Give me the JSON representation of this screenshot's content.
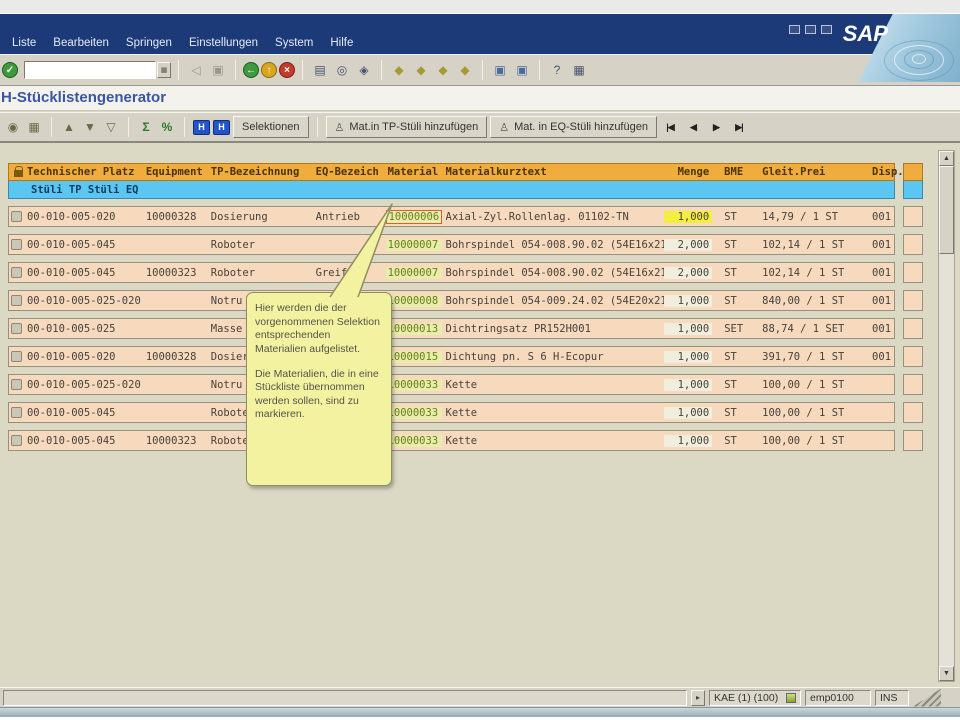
{
  "window": {
    "logo_text": "SAP"
  },
  "menubar": {
    "items": [
      "Liste",
      "Bearbeiten",
      "Springen",
      "Einstellungen",
      "System",
      "Hilfe"
    ]
  },
  "toolbar": {
    "command_value": "",
    "enter_glyph": "✓",
    "pre_icons": [
      {
        "name": "continue-icon",
        "glyph": "◁"
      },
      {
        "name": "save-icon",
        "glyph": "▣"
      }
    ],
    "group_nav": [
      {
        "name": "back-icon",
        "glyph": "←",
        "style": "circ green"
      },
      {
        "name": "exit-icon",
        "glyph": "↑",
        "style": "circ yellow"
      },
      {
        "name": "cancel-icon",
        "glyph": "×",
        "style": "circ red"
      }
    ],
    "group_print": [
      {
        "name": "print-icon",
        "glyph": "▤"
      },
      {
        "name": "find-icon",
        "glyph": "◎"
      },
      {
        "name": "find-next-icon",
        "glyph": "◈"
      }
    ],
    "group_page": [
      {
        "name": "first-page-icon",
        "glyph": "◆"
      },
      {
        "name": "prev-page-icon",
        "glyph": "◆"
      },
      {
        "name": "next-page-icon",
        "glyph": "◆"
      },
      {
        "name": "last-page-icon",
        "glyph": "◆"
      }
    ],
    "group_win": [
      {
        "name": "new-session-icon",
        "glyph": "▣"
      },
      {
        "name": "create-shortcut-icon",
        "glyph": "▣"
      }
    ],
    "group_help": [
      {
        "name": "help-icon",
        "glyph": "?"
      },
      {
        "name": "customize-icon",
        "glyph": "▦"
      }
    ]
  },
  "title": "H-Stücklistengenerator",
  "apptoolbar": {
    "icons_left": [
      {
        "name": "choose-detail-icon",
        "glyph": "◉"
      },
      {
        "name": "grid-view-icon",
        "glyph": "▦"
      }
    ],
    "icons_sort": [
      {
        "name": "sort-ascending-icon",
        "glyph": "▲"
      },
      {
        "name": "sort-descending-icon",
        "glyph": "▼"
      },
      {
        "name": "filter-icon",
        "glyph": "▽"
      }
    ],
    "icons_calc": [
      {
        "name": "sum-icon",
        "glyph": "Σ"
      },
      {
        "name": "subtotal-icon",
        "glyph": "%"
      }
    ],
    "icons_info": [
      {
        "name": "stueli-tp-icon",
        "glyph": "H"
      },
      {
        "name": "stueli-eq-icon",
        "glyph": "H"
      }
    ],
    "selections_label": "Selektionen",
    "add_tp_label": "Mat.in TP-Stüli hinzufügen",
    "add_eq_label": "Mat. in EQ-Stüli hinzufügen",
    "nav": [
      {
        "name": "first-record-icon",
        "glyph": "|◀"
      },
      {
        "name": "prev-record-icon",
        "glyph": "◀"
      },
      {
        "name": "next-record-icon",
        "glyph": "▶"
      },
      {
        "name": "last-record-icon",
        "glyph": "▶|"
      }
    ]
  },
  "table": {
    "columns": [
      "Technischer Platz",
      "Equipment",
      "TP-Bezeichnung",
      "EQ-Bezeich",
      "Material",
      "Materialkurztext",
      "Menge",
      "BME",
      "Gleit.Prei",
      "Disp."
    ],
    "subheader": "Stüli TP Stüli EQ",
    "rows": [
      {
        "tp": "00-010-005-020",
        "equipment": "10000328",
        "tp_bez": "Dosierung",
        "eq_bez": "Antrieb",
        "material": "10000006",
        "text": "Axial-Zyl.Rollenlag. 01102-TN",
        "menge": "1,000",
        "bme": "ST",
        "preis": "14,79 / 1 ST",
        "disp": "001",
        "material_focused": true,
        "menge_focused": true
      },
      {
        "tp": "00-010-005-045",
        "equipment": "",
        "tp_bez": "Roboter",
        "eq_bez": "",
        "material": "10000007",
        "text": "Bohrspindel 054-008.90.02 (54E16x212)",
        "menge": "2,000",
        "bme": "ST",
        "preis": "102,14 / 1 ST",
        "disp": "001"
      },
      {
        "tp": "00-010-005-045",
        "equipment": "10000323",
        "tp_bez": "Roboter",
        "eq_bez": "Greifer",
        "material": "10000007",
        "text": "Bohrspindel 054-008.90.02 (54E16x212)",
        "menge": "2,000",
        "bme": "ST",
        "preis": "102,14 / 1 ST",
        "disp": "001"
      },
      {
        "tp": "00-010-005-025-020",
        "equipment": "",
        "tp_bez": "Notru",
        "eq_bez": "",
        "material": "10000008",
        "text": "Bohrspindel 054-009.24.02 (54E20x210)",
        "menge": "1,000",
        "bme": "ST",
        "preis": "840,00 / 1 ST",
        "disp": "001"
      },
      {
        "tp": "00-010-005-025",
        "equipment": "",
        "tp_bez": "Masse",
        "eq_bez": "",
        "material": "10000013",
        "text": "Dichtringsatz PR152H001",
        "menge": "1,000",
        "bme": "SET",
        "preis": "88,74 / 1 SET",
        "disp": "001"
      },
      {
        "tp": "00-010-005-020",
        "equipment": "10000328",
        "tp_bez": "Dosierung",
        "eq_bez": "",
        "material": "10000015",
        "text": "Dichtung pn. S 6 H-Ecopur",
        "menge": "1,000",
        "bme": "ST",
        "preis": "391,70 / 1 ST",
        "disp": "001"
      },
      {
        "tp": "00-010-005-025-020",
        "equipment": "",
        "tp_bez": "Notru",
        "eq_bez": "",
        "material": "10000033",
        "text": "Kette",
        "menge": "1,000",
        "bme": "ST",
        "preis": "100,00 / 1 ST",
        "disp": ""
      },
      {
        "tp": "00-010-005-045",
        "equipment": "",
        "tp_bez": "Roboter",
        "eq_bez": "",
        "material": "10000033",
        "text": "Kette",
        "menge": "1,000",
        "bme": "ST",
        "preis": "100,00 / 1 ST",
        "disp": ""
      },
      {
        "tp": "00-010-005-045",
        "equipment": "10000323",
        "tp_bez": "Roboter",
        "eq_bez": "",
        "material": "10000033",
        "text": "Kette",
        "menge": "1,000",
        "bme": "ST",
        "preis": "100,00 / 1 ST",
        "disp": ""
      }
    ]
  },
  "callout": {
    "p1": "Hier werden die der vorgenommenen Selektion entsprechenden Materialien aufgelistet.",
    "p2": "Die Materialien, die in eine Stückliste übernommen werden sollen, sind zu markieren."
  },
  "statusbar": {
    "system": "KAE (1) (100)",
    "server": "emp0100",
    "mode": "INS"
  }
}
